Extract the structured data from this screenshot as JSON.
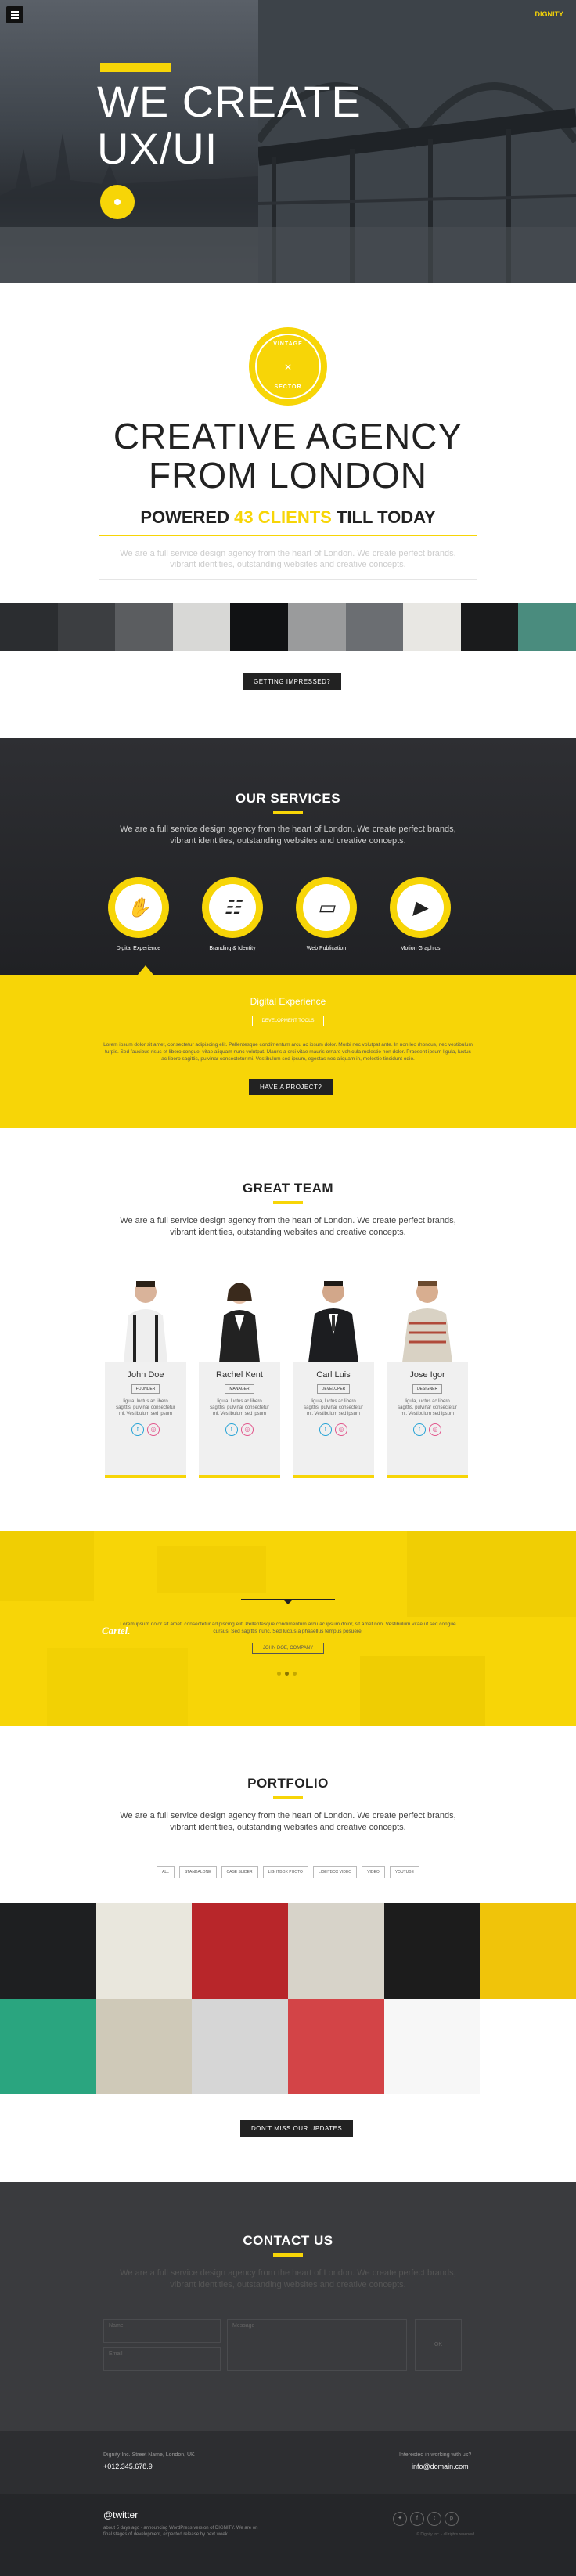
{
  "header": {
    "brand": "DIGNITY",
    "menu_label": "menu"
  },
  "hero": {
    "badge": "",
    "title_line1": "WE CREATE",
    "title_line2": "UX/UI"
  },
  "agency": {
    "seal_top": "VINTAGE",
    "seal_bottom": "SECTOR",
    "title_line1": "CREATIVE AGENCY",
    "title_line2": "FROM LONDON",
    "powered_prefix": "POWERED",
    "powered_highlight": "43 CLIENTS",
    "powered_suffix": "TILL TODAY",
    "desc": "We are a full service design agency from the heart of London. We create perfect brands, vibrant identities, outstanding websites and creative concepts.",
    "button": "GETTING IMPRESSED?"
  },
  "strip_colors": [
    "#2b2d30",
    "#3c3e41",
    "#5b5d60",
    "#d8d8d6",
    "#111214",
    "#9a9b9c",
    "#6b6e72",
    "#e8e7e3",
    "#1a1b1c",
    "#4a8c7e"
  ],
  "services": {
    "title": "OUR SERVICES",
    "desc": "We are a full service design agency from the heart of London. We create perfect brands, vibrant identities, outstanding websites and creative concepts.",
    "items": [
      {
        "label": "Digital Experience",
        "icon": "hand-icon",
        "glyph": "✋"
      },
      {
        "label": "Branding & Identity",
        "icon": "id-card-icon",
        "glyph": "☷"
      },
      {
        "label": "Web Publication",
        "icon": "monitor-icon",
        "glyph": "▭"
      },
      {
        "label": "Motion Graphics",
        "icon": "clapperboard-icon",
        "glyph": "▶"
      }
    ],
    "panel_title": "Digital Experience",
    "panel_button": "DEVELOPMENT TOOLS",
    "panel_text": "Lorem ipsum dolor sit amet, consectetur adipiscing elit. Pellentesque condimentum arcu ac ipsum dolor. Morbi nec volutpat ante. In non leo rhoncus, nec vestibulum turpis. Sed faucibus risus et libero congue, vitae aliquam nunc volutpat. Mauris a orci vitae mauris ornare vehicula molestie non dolor. Praesent ipsum ligula, luctus ac libero sagittis, pulvinar consectetur mi. Vestibulum sed ipsum, egestas nec aliquam in, molestie tincidunt odio.",
    "project_button": "HAVE A PROJECT?"
  },
  "team": {
    "title": "GREAT TEAM",
    "desc": "We are a full service design agency from the heart of London. We create perfect brands, vibrant identities, outstanding websites and creative concepts.",
    "members": [
      {
        "name": "John Doe",
        "role": "FOUNDER",
        "bio": "ligula, luctus ac libero sagittis, pulvinar consectetur mi. Vestibulum sed ipsum"
      },
      {
        "name": "Rachel Kent",
        "role": "MANAGER",
        "bio": "ligula, luctus ac libero sagittis, pulvinar consectetur mi. Vestibulum sed ipsum"
      },
      {
        "name": "Carl Luis",
        "role": "DEVELOPER",
        "bio": "ligula, luctus ac libero sagittis, pulvinar consectetur mi. Vestibulum sed ipsum"
      },
      {
        "name": "Jose Igor",
        "role": "DESIGNER",
        "bio": "ligula, luctus ac libero sagittis, pulvinar consectetur mi. Vestibulum sed ipsum"
      }
    ],
    "twitter_glyph": "t",
    "dribbble_glyph": "◎"
  },
  "testimonial": {
    "logo": "Cartel.",
    "text": "Lorem ipsum dolor sit amet, consectetur adipiscing elit. Pellentesque condimentum arcu ac ipsum dolor, sit amet non. Vestibulum vitae ut sed congue cursus. Sed sagittis nunc. Sed luctus a phasellus tempus posuere.",
    "button": "JOHN DOE, COMPANY"
  },
  "portfolio": {
    "title": "PORTFOLIO",
    "desc": "We are a full service design agency from the heart of London. We create perfect brands, vibrant identities, outstanding websites and creative concepts.",
    "filters": [
      "ALL",
      "STANDALONE",
      "CASE SLIDER",
      "LIGHTBOX PHOTO",
      "LIGHTBOX VIDEO",
      "VIDEO",
      "YOUTUBE"
    ],
    "tiles": [
      "#1e1f21",
      "#e9e7dd",
      "#b8262a",
      "#d7d3c9",
      "#1c1c1c",
      "#f0c40a",
      "#2aa57f",
      "#cfc9b8",
      "#d6d6d6",
      "#d34447",
      "#f7f7f7",
      "#ffffff"
    ],
    "button": "DON'T MISS OUR UPDATES"
  },
  "contact": {
    "title": "CONTACT US",
    "desc": "We are a full service design agency from the heart of London. We create perfect brands, vibrant identities, outstanding websites and creative concepts.",
    "name_placeholder": "Name",
    "email_placeholder": "Email",
    "message_placeholder": "Message",
    "submit": "OK"
  },
  "footer": {
    "address": "Dignity Inc. Street Name, London, UK",
    "phone": "+012.345.678.9",
    "interested": "Interested in working with us?",
    "email": "info@domain.com",
    "twitter_handle": "@twitter",
    "tweet": "about 5 days ago · announcing WordPress version of DIGNITY. We are on final stages of development, expected release by next week.",
    "copyright": "© Dignity Inc. · all rights reserved",
    "social_glyphs": [
      "✦",
      "f",
      "t",
      "p"
    ]
  }
}
